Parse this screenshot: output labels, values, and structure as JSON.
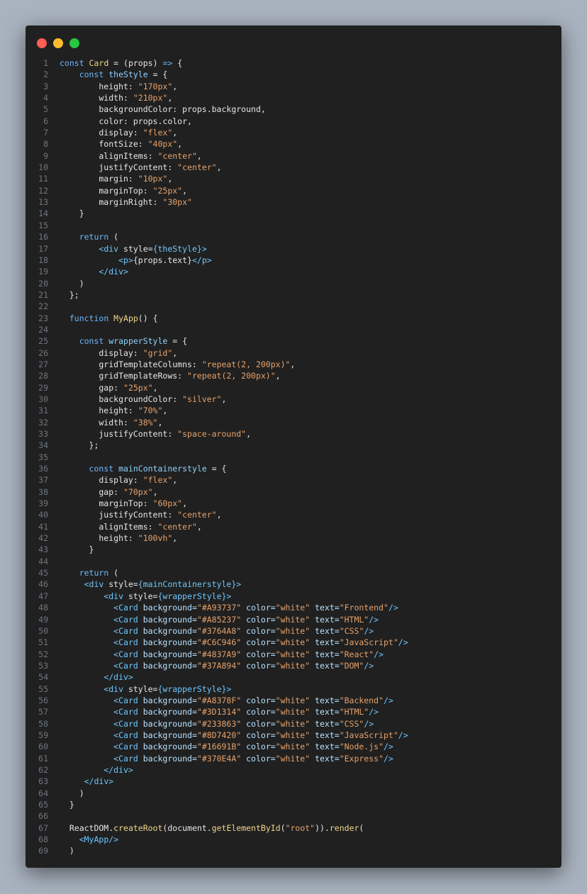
{
  "window": {
    "controls": [
      "close",
      "minimize",
      "maximize"
    ]
  },
  "lines": [
    [
      [
        "k",
        "const "
      ],
      [
        "f",
        "Card"
      ],
      [
        "p",
        " = ("
      ],
      [
        "p",
        "props"
      ],
      [
        "p",
        ") "
      ],
      [
        "k",
        "=>"
      ],
      [
        "p",
        " {"
      ]
    ],
    [
      [
        "p",
        "    "
      ],
      [
        "k",
        "const "
      ],
      [
        "v",
        "theStyle"
      ],
      [
        "p",
        " = {"
      ]
    ],
    [
      [
        "p",
        "        height: "
      ],
      [
        "s",
        "\"170px\""
      ],
      [
        "p",
        ","
      ]
    ],
    [
      [
        "p",
        "        width: "
      ],
      [
        "s",
        "\"210px\""
      ],
      [
        "p",
        ","
      ]
    ],
    [
      [
        "p",
        "        backgroundColor: props.background,"
      ]
    ],
    [
      [
        "p",
        "        color: props.color,"
      ]
    ],
    [
      [
        "p",
        "        display: "
      ],
      [
        "s",
        "\"flex\""
      ],
      [
        "p",
        ","
      ]
    ],
    [
      [
        "p",
        "        fontSize: "
      ],
      [
        "s",
        "\"40px\""
      ],
      [
        "p",
        ","
      ]
    ],
    [
      [
        "p",
        "        alignItems: "
      ],
      [
        "s",
        "\"center\""
      ],
      [
        "p",
        ","
      ]
    ],
    [
      [
        "p",
        "        justifyContent: "
      ],
      [
        "s",
        "\"center\""
      ],
      [
        "p",
        ","
      ]
    ],
    [
      [
        "p",
        "        margin: "
      ],
      [
        "s",
        "\"10px\""
      ],
      [
        "p",
        ","
      ]
    ],
    [
      [
        "p",
        "        marginTop: "
      ],
      [
        "s",
        "\"25px\""
      ],
      [
        "p",
        ","
      ]
    ],
    [
      [
        "p",
        "        marginRight: "
      ],
      [
        "s",
        "\"30px\""
      ]
    ],
    [
      [
        "p",
        "    }"
      ]
    ],
    [
      [
        "p",
        ""
      ]
    ],
    [
      [
        "p",
        "    "
      ],
      [
        "k",
        "return"
      ],
      [
        "p",
        " ("
      ]
    ],
    [
      [
        "p",
        "        "
      ],
      [
        "t",
        "<div"
      ],
      [
        "p",
        " style="
      ],
      [
        "t",
        "{theStyle}"
      ],
      [
        "t",
        ">"
      ]
    ],
    [
      [
        "p",
        "            "
      ],
      [
        "t",
        "<p>"
      ],
      [
        "p",
        "{props.text}"
      ],
      [
        "t",
        "</p>"
      ]
    ],
    [
      [
        "p",
        "        "
      ],
      [
        "t",
        "</div>"
      ]
    ],
    [
      [
        "p",
        "    )"
      ]
    ],
    [
      [
        "p",
        "  };"
      ]
    ],
    [
      [
        "p",
        ""
      ]
    ],
    [
      [
        "p",
        "  "
      ],
      [
        "k",
        "function "
      ],
      [
        "f",
        "MyApp"
      ],
      [
        "p",
        "() {"
      ]
    ],
    [
      [
        "p",
        ""
      ]
    ],
    [
      [
        "p",
        "    "
      ],
      [
        "k",
        "const "
      ],
      [
        "v",
        "wrapperStyle"
      ],
      [
        "p",
        " = {"
      ]
    ],
    [
      [
        "p",
        "        display: "
      ],
      [
        "s",
        "\"grid\""
      ],
      [
        "p",
        ","
      ]
    ],
    [
      [
        "p",
        "        gridTemplateColumns: "
      ],
      [
        "s",
        "\"repeat(2, 200px)\""
      ],
      [
        "p",
        ","
      ]
    ],
    [
      [
        "p",
        "        gridTemplateRows: "
      ],
      [
        "s",
        "\"repeat(2, 200px)\""
      ],
      [
        "p",
        ","
      ]
    ],
    [
      [
        "p",
        "        gap: "
      ],
      [
        "s",
        "\"25px\""
      ],
      [
        "p",
        ","
      ]
    ],
    [
      [
        "p",
        "        backgroundColor: "
      ],
      [
        "s",
        "\"silver\""
      ],
      [
        "p",
        ","
      ]
    ],
    [
      [
        "p",
        "        height: "
      ],
      [
        "s",
        "\"70%\""
      ],
      [
        "p",
        ","
      ]
    ],
    [
      [
        "p",
        "        width: "
      ],
      [
        "s",
        "\"38%\""
      ],
      [
        "p",
        ","
      ]
    ],
    [
      [
        "p",
        "        justifyContent: "
      ],
      [
        "s",
        "\"space-around\""
      ],
      [
        "p",
        ","
      ]
    ],
    [
      [
        "p",
        "      };"
      ]
    ],
    [
      [
        "p",
        ""
      ]
    ],
    [
      [
        "p",
        "      "
      ],
      [
        "k",
        "const "
      ],
      [
        "v",
        "mainContainerstyle"
      ],
      [
        "p",
        " = {"
      ]
    ],
    [
      [
        "p",
        "        display: "
      ],
      [
        "s",
        "\"flex\""
      ],
      [
        "p",
        ","
      ]
    ],
    [
      [
        "p",
        "        gap: "
      ],
      [
        "s",
        "\"70px\""
      ],
      [
        "p",
        ","
      ]
    ],
    [
      [
        "p",
        "        marginTop: "
      ],
      [
        "s",
        "\"60px\""
      ],
      [
        "p",
        ","
      ]
    ],
    [
      [
        "p",
        "        justifyContent: "
      ],
      [
        "s",
        "\"center\""
      ],
      [
        "p",
        ","
      ]
    ],
    [
      [
        "p",
        "        alignItems: "
      ],
      [
        "s",
        "\"center\""
      ],
      [
        "p",
        ","
      ]
    ],
    [
      [
        "p",
        "        height: "
      ],
      [
        "s",
        "\"100vh\""
      ],
      [
        "p",
        ","
      ]
    ],
    [
      [
        "p",
        "      }"
      ]
    ],
    [
      [
        "p",
        ""
      ]
    ],
    [
      [
        "p",
        "    "
      ],
      [
        "k",
        "return"
      ],
      [
        "p",
        " ("
      ]
    ],
    [
      [
        "p",
        "     "
      ],
      [
        "t",
        "<div"
      ],
      [
        "p",
        " style="
      ],
      [
        "t",
        "{mainContainerstyle}"
      ],
      [
        "t",
        ">"
      ]
    ],
    [
      [
        "p",
        "         "
      ],
      [
        "t",
        "<div"
      ],
      [
        "p",
        " style="
      ],
      [
        "t",
        "{wrapperStyle}"
      ],
      [
        "t",
        ">"
      ]
    ],
    [
      [
        "p",
        "           "
      ],
      [
        "t",
        "<Card"
      ],
      [
        "a",
        " background="
      ],
      [
        "s",
        "\"#A93737\""
      ],
      [
        "a",
        " color="
      ],
      [
        "s",
        "\"white\""
      ],
      [
        "a",
        " text="
      ],
      [
        "s",
        "\"Frontend\""
      ],
      [
        "t",
        "/>"
      ]
    ],
    [
      [
        "p",
        "           "
      ],
      [
        "t",
        "<Card"
      ],
      [
        "a",
        " background="
      ],
      [
        "s",
        "\"#A85237\""
      ],
      [
        "a",
        " color="
      ],
      [
        "s",
        "\"white\""
      ],
      [
        "a",
        " text="
      ],
      [
        "s",
        "\"HTML\""
      ],
      [
        "t",
        "/>"
      ]
    ],
    [
      [
        "p",
        "           "
      ],
      [
        "t",
        "<Card"
      ],
      [
        "a",
        " background="
      ],
      [
        "s",
        "\"#3764A8\""
      ],
      [
        "a",
        " color="
      ],
      [
        "s",
        "\"white\""
      ],
      [
        "a",
        " text="
      ],
      [
        "s",
        "\"CSS\""
      ],
      [
        "t",
        "/>"
      ]
    ],
    [
      [
        "p",
        "           "
      ],
      [
        "t",
        "<Card"
      ],
      [
        "a",
        " background="
      ],
      [
        "s",
        "\"#C6C946\""
      ],
      [
        "a",
        " color="
      ],
      [
        "s",
        "\"white\""
      ],
      [
        "a",
        " text="
      ],
      [
        "s",
        "\"JavaScript\""
      ],
      [
        "t",
        "/>"
      ]
    ],
    [
      [
        "p",
        "           "
      ],
      [
        "t",
        "<Card"
      ],
      [
        "a",
        " background="
      ],
      [
        "s",
        "\"#4837A9\""
      ],
      [
        "a",
        " color="
      ],
      [
        "s",
        "\"white\""
      ],
      [
        "a",
        " text="
      ],
      [
        "s",
        "\"React\""
      ],
      [
        "t",
        "/>"
      ]
    ],
    [
      [
        "p",
        "           "
      ],
      [
        "t",
        "<Card"
      ],
      [
        "a",
        " background="
      ],
      [
        "s",
        "\"#37A894\""
      ],
      [
        "a",
        " color="
      ],
      [
        "s",
        "\"white\""
      ],
      [
        "a",
        " text="
      ],
      [
        "s",
        "\"DOM\""
      ],
      [
        "t",
        "/>"
      ]
    ],
    [
      [
        "p",
        "         "
      ],
      [
        "t",
        "</div>"
      ]
    ],
    [
      [
        "p",
        "         "
      ],
      [
        "t",
        "<div"
      ],
      [
        "p",
        " style="
      ],
      [
        "t",
        "{wrapperStyle}"
      ],
      [
        "t",
        ">"
      ]
    ],
    [
      [
        "p",
        "           "
      ],
      [
        "t",
        "<Card"
      ],
      [
        "a",
        " background="
      ],
      [
        "s",
        "\"#A8378F\""
      ],
      [
        "a",
        " color="
      ],
      [
        "s",
        "\"white\""
      ],
      [
        "a",
        " text="
      ],
      [
        "s",
        "\"Backend\""
      ],
      [
        "t",
        "/>"
      ]
    ],
    [
      [
        "p",
        "           "
      ],
      [
        "t",
        "<Card"
      ],
      [
        "a",
        " background="
      ],
      [
        "s",
        "\"#3D1314\""
      ],
      [
        "a",
        " color="
      ],
      [
        "s",
        "\"white\""
      ],
      [
        "a",
        " text="
      ],
      [
        "s",
        "\"HTML\""
      ],
      [
        "t",
        "/>"
      ]
    ],
    [
      [
        "p",
        "           "
      ],
      [
        "t",
        "<Card"
      ],
      [
        "a",
        " background="
      ],
      [
        "s",
        "\"#233863\""
      ],
      [
        "a",
        " color="
      ],
      [
        "s",
        "\"white\""
      ],
      [
        "a",
        " text="
      ],
      [
        "s",
        "\"CSS\""
      ],
      [
        "t",
        "/>"
      ]
    ],
    [
      [
        "p",
        "           "
      ],
      [
        "t",
        "<Card"
      ],
      [
        "a",
        " background="
      ],
      [
        "s",
        "\"#8D7420\""
      ],
      [
        "a",
        " color="
      ],
      [
        "s",
        "\"white\""
      ],
      [
        "a",
        " text="
      ],
      [
        "s",
        "\"JavaScript\""
      ],
      [
        "t",
        "/>"
      ]
    ],
    [
      [
        "p",
        "           "
      ],
      [
        "t",
        "<Card"
      ],
      [
        "a",
        " background="
      ],
      [
        "s",
        "\"#16691B\""
      ],
      [
        "a",
        " color="
      ],
      [
        "s",
        "\"white\""
      ],
      [
        "a",
        " text="
      ],
      [
        "s",
        "\"Node.js\""
      ],
      [
        "t",
        "/>"
      ]
    ],
    [
      [
        "p",
        "           "
      ],
      [
        "t",
        "<Card"
      ],
      [
        "a",
        " background="
      ],
      [
        "s",
        "\"#370E4A\""
      ],
      [
        "a",
        " color="
      ],
      [
        "s",
        "\"white\""
      ],
      [
        "a",
        " text="
      ],
      [
        "s",
        "\"Express\""
      ],
      [
        "t",
        "/>"
      ]
    ],
    [
      [
        "p",
        "         "
      ],
      [
        "t",
        "</div>"
      ]
    ],
    [
      [
        "p",
        "     "
      ],
      [
        "t",
        "</div>"
      ]
    ],
    [
      [
        "p",
        "    )"
      ]
    ],
    [
      [
        "p",
        "  }"
      ]
    ],
    [
      [
        "p",
        ""
      ]
    ],
    [
      [
        "p",
        "  ReactDOM."
      ],
      [
        "f",
        "createRoot"
      ],
      [
        "p",
        "(document."
      ],
      [
        "f",
        "getElementById"
      ],
      [
        "p",
        "("
      ],
      [
        "s",
        "\"root\""
      ],
      [
        "p",
        "))."
      ],
      [
        "f",
        "render"
      ],
      [
        "p",
        "("
      ]
    ],
    [
      [
        "p",
        "    "
      ],
      [
        "t",
        "<MyApp/>"
      ]
    ],
    [
      [
        "p",
        "  )"
      ]
    ]
  ]
}
